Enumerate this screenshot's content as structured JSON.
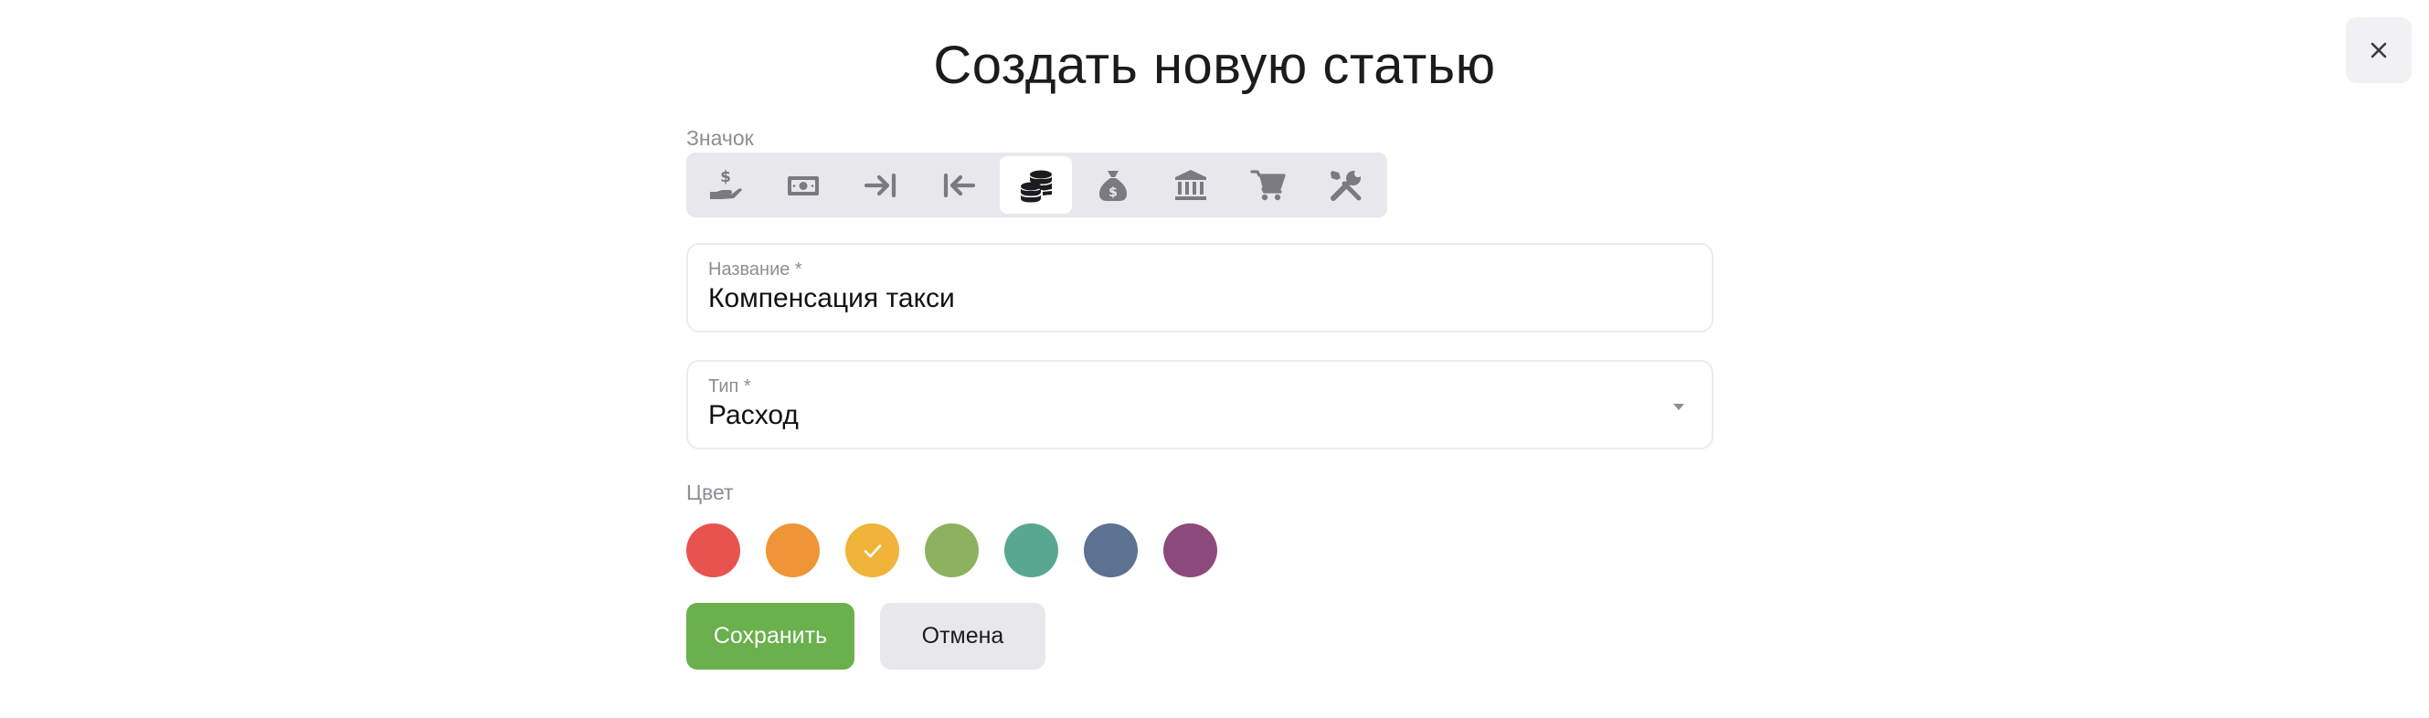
{
  "dialog": {
    "title": "Создать новую статью"
  },
  "icon_picker": {
    "label": "Значок",
    "selected_index": 4,
    "icons": [
      "hand-holding-dollar-icon",
      "money-bill-icon",
      "arrow-right-to-bar-icon",
      "arrow-left-from-bar-icon",
      "coins-icon",
      "money-bag-icon",
      "bank-icon",
      "shopping-cart-icon",
      "tools-icon"
    ],
    "icon_color": "#7a7a80",
    "selected_icon_color": "#1c1c1e"
  },
  "name_field": {
    "label": "Название *",
    "value": "Компенсация такси"
  },
  "type_field": {
    "label": "Тип *",
    "value": "Расход"
  },
  "color_picker": {
    "label": "Цвет",
    "selected_index": 2,
    "colors": [
      "#e8524f",
      "#ee9538",
      "#f0b43a",
      "#8cb25f",
      "#5aa78f",
      "#5b7291",
      "#8c4a7a"
    ]
  },
  "actions": {
    "save_label": "Сохранить",
    "cancel_label": "Отмена"
  }
}
